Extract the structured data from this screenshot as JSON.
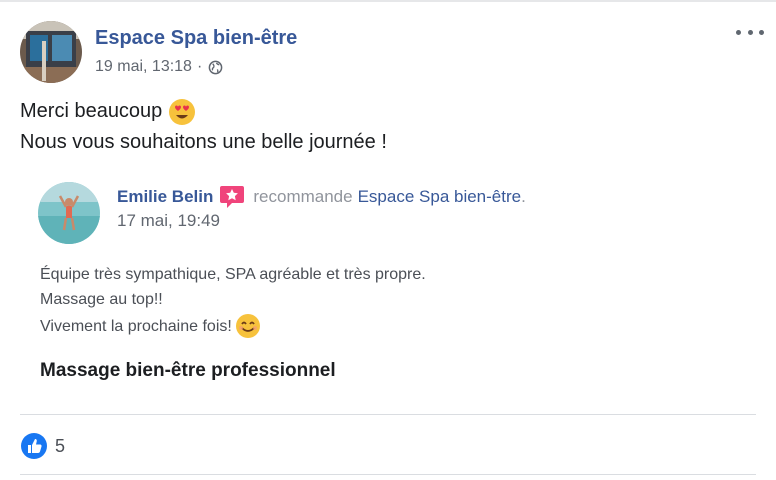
{
  "post": {
    "page_name": "Espace Spa bien-être",
    "date": "19 mai, 13:18",
    "separator": "·",
    "privacy_icon": "globe-icon",
    "more_icon": "more-options-icon",
    "text_line1": "Merci beaucoup",
    "text_line1_emoji": "heart-eyes-emoji",
    "text_line2": "Nous vous souhaitons une belle journée !"
  },
  "review": {
    "reviewer_name": "Emilie Belin",
    "badge_icon": "star-badge-icon",
    "verb": "recommande",
    "page_name": "Espace Spa bien-être",
    "period": ".",
    "date": "17 mai, 19:49",
    "lines": [
      "Équipe très sympathique, SPA agréable et très propre.",
      "Massage au top!!",
      "Vivement la prochaine fois!"
    ],
    "last_line_emoji": "smiling-face-emoji",
    "service": "Massage bien-être professionnel"
  },
  "reactions": {
    "icon": "like-icon",
    "count": "5"
  },
  "colors": {
    "link_blue": "#385898",
    "meta_gray": "#616770",
    "like_blue": "#1877f2",
    "badge_pink": "#f0447b"
  }
}
